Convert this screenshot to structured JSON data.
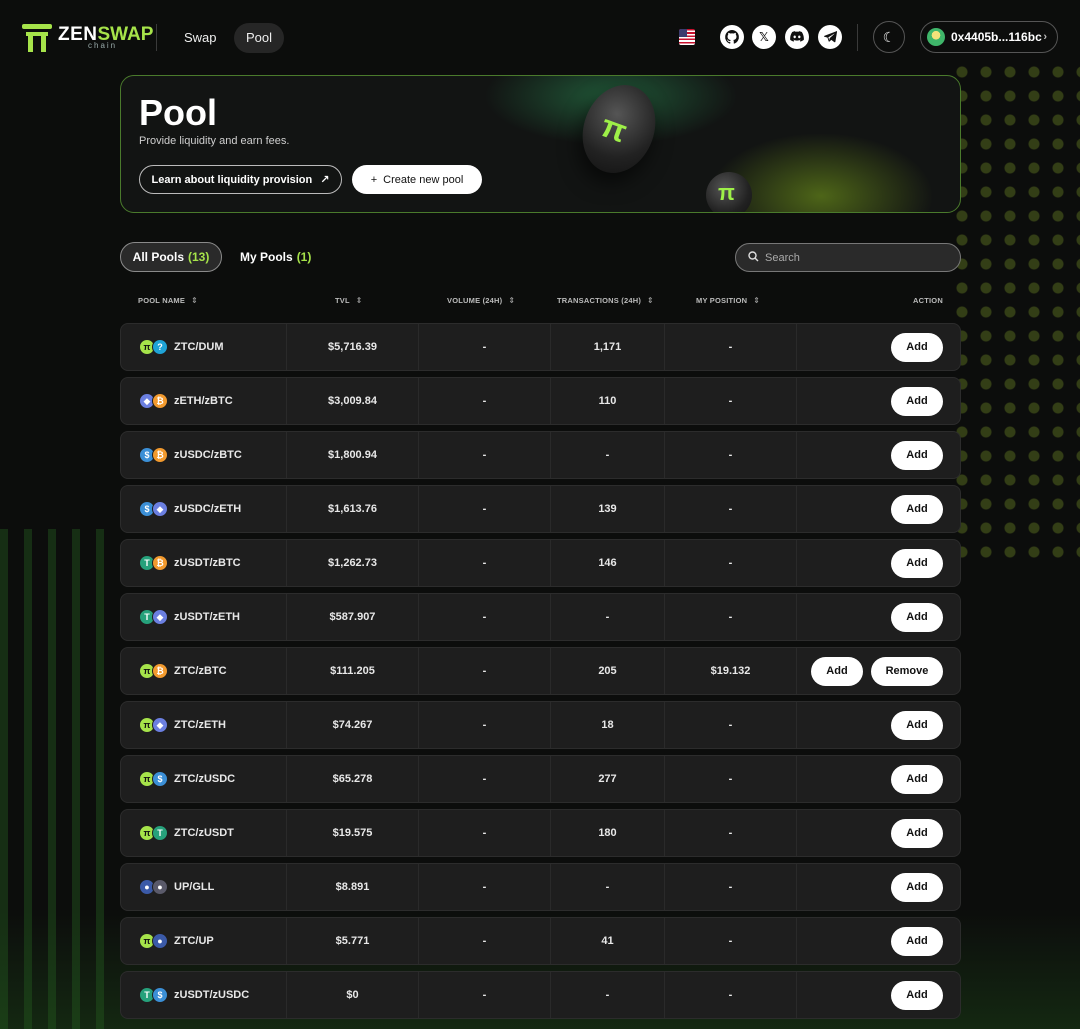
{
  "header": {
    "logo": {
      "zen": "ZEN",
      "swap": "SWAP",
      "chain": "chain"
    },
    "nav": {
      "swap": "Swap",
      "pool": "Pool"
    },
    "wallet_address": "0x4405b...116bc"
  },
  "hero": {
    "title": "Pool",
    "subtitle": "Provide liquidity and earn fees.",
    "learn_button": "Learn about liquidity provision",
    "create_button": "Create new pool"
  },
  "tabs": {
    "all_label": "All Pools",
    "all_count": "(13)",
    "my_label": "My Pools",
    "my_count": "(1)"
  },
  "search": {
    "placeholder": "Search"
  },
  "columns": {
    "name": "POOL NAME",
    "tvl": "TVL",
    "volume": "VOLUME (24H)",
    "transactions": "TRANSACTIONS (24H)",
    "position": "MY POSITION",
    "action": "ACTION"
  },
  "buttons": {
    "add": "Add",
    "remove": "Remove"
  },
  "token_colors": {
    "ZTC": "#a6e34a",
    "DUM": "#1fa3d6",
    "zETH": "#6b7fe0",
    "zBTC": "#f29a2e",
    "zUSDC": "#3b8fd6",
    "zUSDT": "#26a17b",
    "UP": "#3b5aa8",
    "GLL": "#5a5a6a"
  },
  "rows": [
    {
      "name": "ZTC/DUM",
      "t1": "ZTC",
      "t2": "DUM",
      "tvl": "$5,716.39",
      "volume": "-",
      "tx": "1,171",
      "position": "-",
      "remove": false
    },
    {
      "name": "zETH/zBTC",
      "t1": "zETH",
      "t2": "zBTC",
      "tvl": "$3,009.84",
      "volume": "-",
      "tx": "110",
      "position": "-",
      "remove": false
    },
    {
      "name": "zUSDC/zBTC",
      "t1": "zUSDC",
      "t2": "zBTC",
      "tvl": "$1,800.94",
      "volume": "-",
      "tx": "-",
      "position": "-",
      "remove": false
    },
    {
      "name": "zUSDC/zETH",
      "t1": "zUSDC",
      "t2": "zETH",
      "tvl": "$1,613.76",
      "volume": "-",
      "tx": "139",
      "position": "-",
      "remove": false
    },
    {
      "name": "zUSDT/zBTC",
      "t1": "zUSDT",
      "t2": "zBTC",
      "tvl": "$1,262.73",
      "volume": "-",
      "tx": "146",
      "position": "-",
      "remove": false
    },
    {
      "name": "zUSDT/zETH",
      "t1": "zUSDT",
      "t2": "zETH",
      "tvl": "$587.907",
      "volume": "-",
      "tx": "-",
      "position": "-",
      "remove": false
    },
    {
      "name": "ZTC/zBTC",
      "t1": "ZTC",
      "t2": "zBTC",
      "tvl": "$111.205",
      "volume": "-",
      "tx": "205",
      "position": "$19.132",
      "remove": true
    },
    {
      "name": "ZTC/zETH",
      "t1": "ZTC",
      "t2": "zETH",
      "tvl": "$74.267",
      "volume": "-",
      "tx": "18",
      "position": "-",
      "remove": false
    },
    {
      "name": "ZTC/zUSDC",
      "t1": "ZTC",
      "t2": "zUSDC",
      "tvl": "$65.278",
      "volume": "-",
      "tx": "277",
      "position": "-",
      "remove": false
    },
    {
      "name": "ZTC/zUSDT",
      "t1": "ZTC",
      "t2": "zUSDT",
      "tvl": "$19.575",
      "volume": "-",
      "tx": "180",
      "position": "-",
      "remove": false
    },
    {
      "name": "UP/GLL",
      "t1": "UP",
      "t2": "GLL",
      "tvl": "$8.891",
      "volume": "-",
      "tx": "-",
      "position": "-",
      "remove": false
    },
    {
      "name": "ZTC/UP",
      "t1": "ZTC",
      "t2": "UP",
      "tvl": "$5.771",
      "volume": "-",
      "tx": "41",
      "position": "-",
      "remove": false
    },
    {
      "name": "zUSDT/zUSDC",
      "t1": "zUSDT",
      "t2": "zUSDC",
      "tvl": "$0",
      "volume": "-",
      "tx": "-",
      "position": "-",
      "remove": false
    }
  ]
}
